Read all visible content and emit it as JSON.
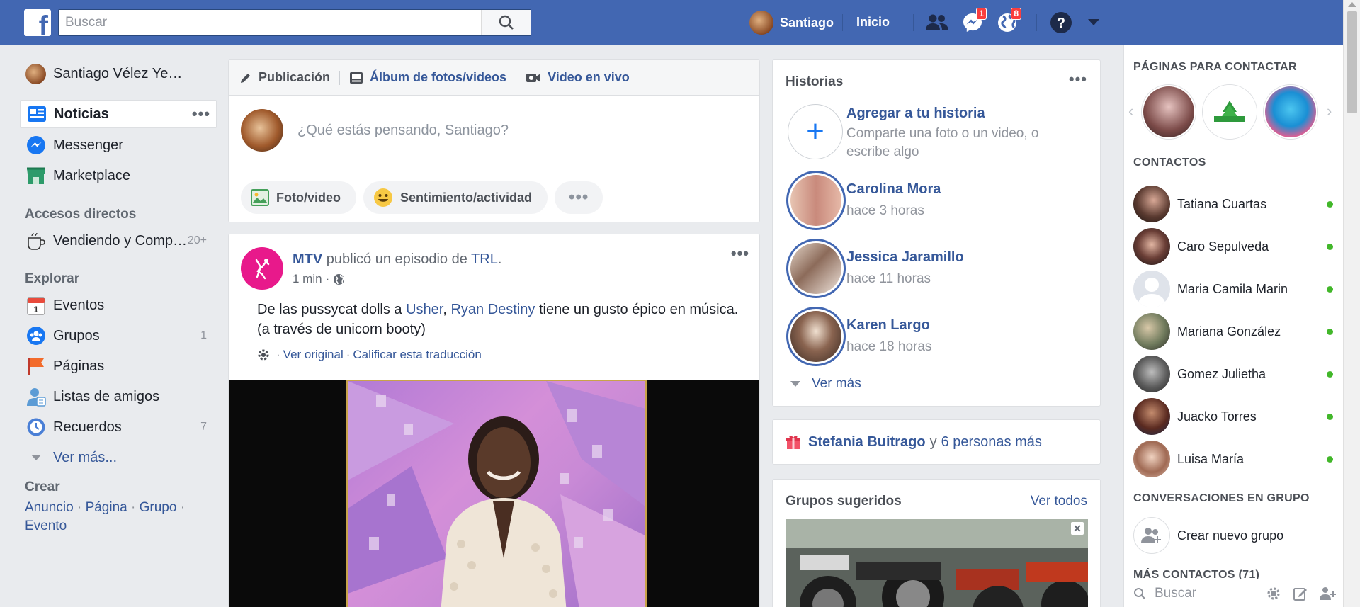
{
  "topbar": {
    "logo": "f",
    "search_placeholder": "Buscar",
    "user_name": "Santiago",
    "home_label": "Inicio",
    "messages_badge": "1",
    "notifications_badge": "8",
    "brand_color": "#4267b2"
  },
  "left_nav": {
    "user_name": "Santiago Vélez Ye…",
    "items": [
      {
        "label": "Noticias",
        "icon": "news-feed-icon"
      },
      {
        "label": "Messenger",
        "icon": "messenger-icon"
      },
      {
        "label": "Marketplace",
        "icon": "marketplace-icon"
      }
    ],
    "shortcuts_heading": "Accesos directos",
    "shortcut": {
      "label": "Vendiendo y Comp…",
      "count": "20+"
    },
    "explore_heading": "Explorar",
    "explore": [
      {
        "label": "Eventos",
        "count": ""
      },
      {
        "label": "Grupos",
        "count": "1"
      },
      {
        "label": "Páginas",
        "count": ""
      },
      {
        "label": "Listas de amigos",
        "count": ""
      },
      {
        "label": "Recuerdos",
        "count": "7"
      }
    ],
    "see_more": "Ver más...",
    "create_heading": "Crear",
    "create_links": [
      "Anuncio",
      "Página",
      "Grupo",
      "Evento"
    ]
  },
  "composer": {
    "tabs": [
      "Publicación",
      "Álbum de fotos/videos",
      "Video en vivo"
    ],
    "placeholder": "¿Qué estás pensando, Santiago?",
    "actions": [
      "Foto/video",
      "Sentimiento/actividad"
    ]
  },
  "post": {
    "author": "MTV",
    "verb": "publicó un episodio de",
    "show": "TRL",
    "time": "1 min",
    "text_1": "De las pussycat dolls a",
    "mention_1": "Usher",
    "mention_2": "Ryan Destiny",
    "text_2": "tiene un gusto épico en música. (a través de unicorn booty)",
    "see_original": "Ver original",
    "rate_translation": "Calificar esta traducción"
  },
  "stories": {
    "title": "Historias",
    "add_title": "Agregar a tu historia",
    "add_sub": "Comparte una foto o un video, o escribe algo",
    "items": [
      {
        "name": "Carolina Mora",
        "time": "hace 3 horas"
      },
      {
        "name": "Jessica Jaramillo",
        "time": "hace 11 horas"
      },
      {
        "name": "Karen Largo",
        "time": "hace 18 horas"
      }
    ],
    "see_more": "Ver más"
  },
  "birthday": {
    "name": "Stefania Buitrago",
    "connector": "y",
    "others": "6 personas más"
  },
  "groups": {
    "title": "Grupos sugeridos",
    "see_all": "Ver todos"
  },
  "right_bar": {
    "pages_heading": "PÁGINAS PARA CONTACTAR",
    "contacts_heading": "CONTACTOS",
    "contacts": [
      "Tatiana Cuartas",
      "Caro Sepulveda",
      "Maria Camila Marin",
      "Mariana González",
      "Gomez Julietha",
      "Juacko Torres",
      "Luisa María"
    ],
    "group_convos_heading": "CONVERSACIONES EN GRUPO",
    "new_group": "Crear nuevo grupo",
    "more_contacts": "MÁS CONTACTOS (71)",
    "search_placeholder": "Buscar",
    "online_color": "#42b72a"
  }
}
